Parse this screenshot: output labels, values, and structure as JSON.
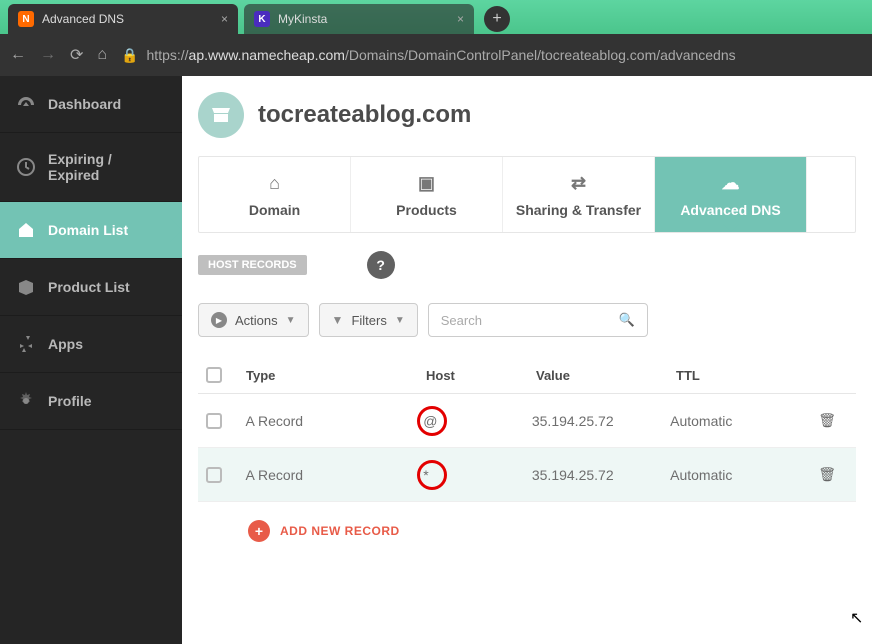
{
  "browser": {
    "tabs": [
      {
        "title": "Advanced DNS",
        "favicon": "N",
        "favclass": "fav-nc",
        "active": true
      },
      {
        "title": "MyKinsta",
        "favicon": "K",
        "favclass": "fav-mk",
        "active": false
      }
    ],
    "url_prefix": "https://",
    "url_host": "ap.www.namecheap.com",
    "url_path": "/Domains/DomainControlPanel/tocreateablog.com/advancedns"
  },
  "sidebar": {
    "items": [
      {
        "label": "Dashboard",
        "icon": "gauge",
        "active": false
      },
      {
        "label": "Expiring / Expired",
        "icon": "clock",
        "active": false
      },
      {
        "label": "Domain List",
        "icon": "house",
        "active": true
      },
      {
        "label": "Product List",
        "icon": "box",
        "active": false
      },
      {
        "label": "Apps",
        "icon": "apps",
        "active": false
      },
      {
        "label": "Profile",
        "icon": "gear",
        "active": false
      }
    ]
  },
  "header": {
    "domain": "tocreateablog.com"
  },
  "tabs": [
    {
      "label": "Domain",
      "icon": "house"
    },
    {
      "label": "Products",
      "icon": "box"
    },
    {
      "label": "Sharing & Transfer",
      "icon": "share"
    },
    {
      "label": "Advanced DNS",
      "icon": "dns",
      "selected": true
    }
  ],
  "section": {
    "label": "HOST RECORDS"
  },
  "toolbar": {
    "actions_label": "Actions",
    "filters_label": "Filters",
    "search_placeholder": "Search"
  },
  "table": {
    "headers": {
      "type": "Type",
      "host": "Host",
      "value": "Value",
      "ttl": "TTL"
    },
    "rows": [
      {
        "type": "A Record",
        "host": "@",
        "value": "35.194.25.72",
        "ttl": "Automatic"
      },
      {
        "type": "A Record",
        "host": "*",
        "value": "35.194.25.72",
        "ttl": "Automatic"
      }
    ],
    "add_label": "ADD NEW RECORD"
  }
}
